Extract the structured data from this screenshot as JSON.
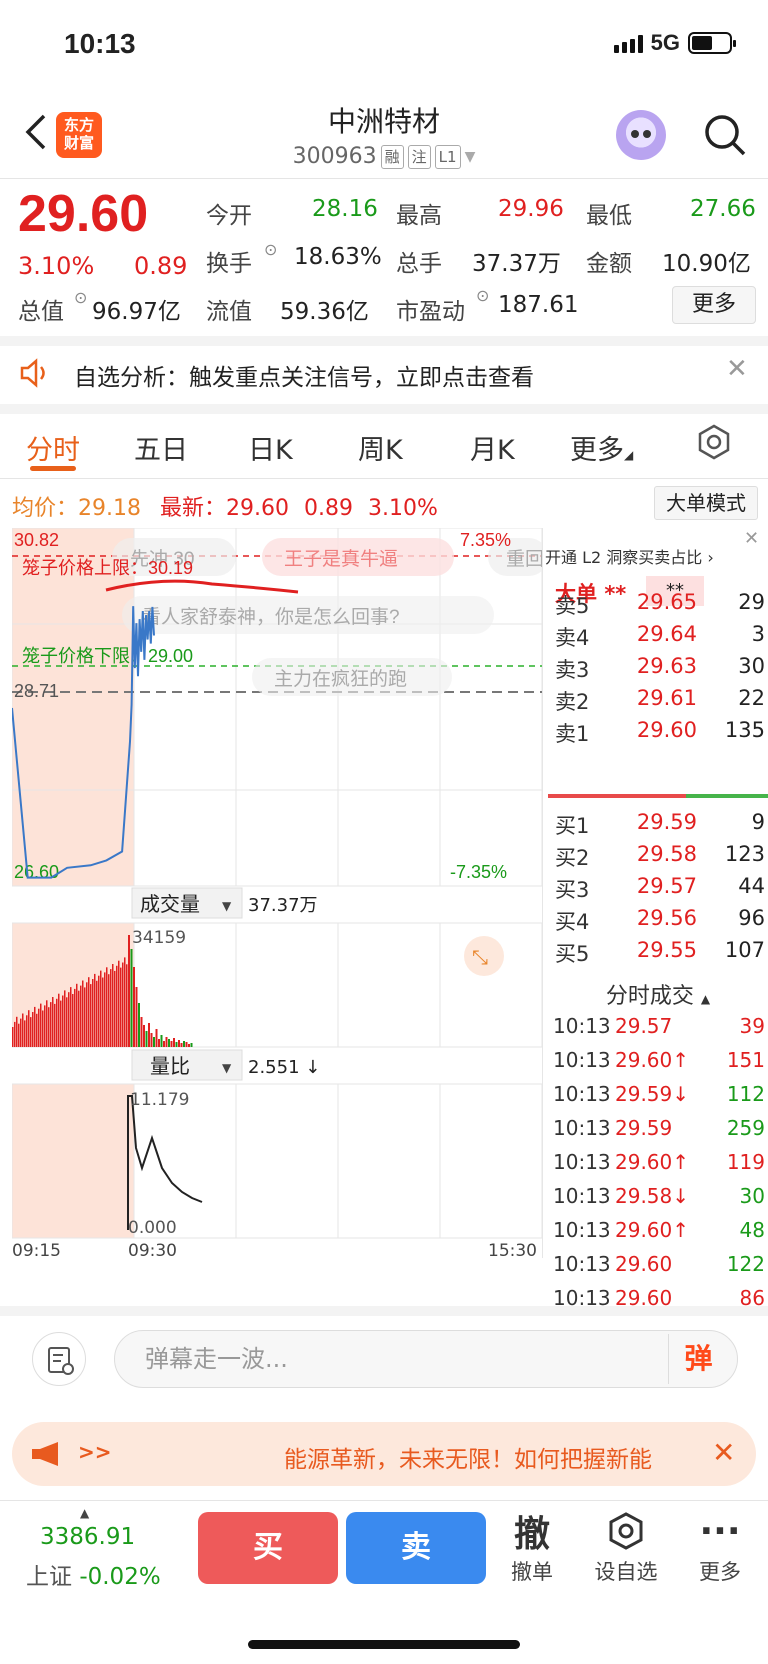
{
  "status": {
    "time": "10:13",
    "network": "5G"
  },
  "header": {
    "logo": "东方\n财富",
    "name": "中洲特材",
    "code": "300963",
    "tags": [
      "融",
      "注",
      "L1"
    ]
  },
  "quote": {
    "price": "29.60",
    "change_pct": "3.10%",
    "change_amt": "0.89",
    "fields": [
      {
        "label": "今开",
        "value": "28.16",
        "color": "green"
      },
      {
        "label": "最高",
        "value": "29.96",
        "color": "red"
      },
      {
        "label": "最低",
        "value": "27.66",
        "color": "green"
      },
      {
        "label": "换手",
        "value": "18.63%",
        "color": ""
      },
      {
        "label": "总手",
        "value": "37.37万",
        "color": ""
      },
      {
        "label": "金额",
        "value": "10.90亿",
        "color": ""
      },
      {
        "label": "总值",
        "value": "96.97亿",
        "color": ""
      },
      {
        "label": "流值",
        "value": "59.36亿",
        "color": ""
      },
      {
        "label": "市盈动",
        "value": "187.61",
        "color": ""
      }
    ],
    "more_label": "更多"
  },
  "banner": {
    "text": "自选分析：触发重点关注信号，立即点击查看"
  },
  "tabs": [
    "分时",
    "五日",
    "日K",
    "周K",
    "月K",
    "更多"
  ],
  "chart_info": {
    "avg_label": "均价：",
    "avg_value": "29.18",
    "latest_label": "最新：",
    "latest_price": "29.60",
    "latest_chg": "0.89",
    "latest_pct": "3.10%",
    "big_order_btn": "大单模式"
  },
  "chart_labels": {
    "top_price": "30.82",
    "top_pct": "7.35%",
    "mid_price": "28.71",
    "bottom_price": "26.60",
    "bottom_pct": "-7.35%",
    "upper_label": "笼子价格上限：30.19",
    "lower_label": "笼子价格下限：29.00",
    "danmu": [
      "先冲 30",
      "王子是真牛逼",
      "重回",
      "看人家舒泰神，你是怎么回事?",
      "主力在疯狂的跑"
    ],
    "volume_title": "成交量",
    "volume_total": "37.37万",
    "volume_max": "34159",
    "ratio_title": "量比",
    "ratio_value": "2.551 ↓",
    "ratio_max": "11.179",
    "ratio_min": "0.000",
    "time_start": "09:15",
    "time_open": "09:30",
    "time_end": "15:30"
  },
  "chart_data": {
    "type": "line",
    "ylim": [
      26.6,
      30.82
    ],
    "prev_close": 28.71,
    "series": [
      {
        "name": "price",
        "x": [
          "09:15",
          "09:17",
          "09:20",
          "09:22",
          "09:25",
          "09:27",
          "09:29",
          "09:30",
          "09:31",
          "09:32",
          "09:33",
          "09:34",
          "09:35",
          "09:36",
          "09:37",
          "09:38",
          "09:39",
          "09:40",
          "09:41",
          "09:42",
          "09:43",
          "09:44",
          "09:45"
        ],
        "values": [
          28.71,
          26.63,
          26.63,
          26.75,
          26.78,
          26.84,
          26.95,
          28.3,
          28.75,
          29.96,
          29.2,
          29.75,
          29.1,
          29.8,
          29.4,
          29.9,
          29.3,
          29.85,
          29.55,
          29.9,
          29.5,
          29.95,
          29.6
        ]
      }
    ]
  },
  "orderbook": {
    "l2_text": "开通 L2 洞察买卖占比",
    "big_label": "大单",
    "big_stars": "**",
    "big_stars2": "**",
    "sells": [
      {
        "label": "卖5",
        "price": "29.65",
        "vol": "29"
      },
      {
        "label": "卖4",
        "price": "29.64",
        "vol": "3"
      },
      {
        "label": "卖3",
        "price": "29.63",
        "vol": "30"
      },
      {
        "label": "卖2",
        "price": "29.61",
        "vol": "22"
      },
      {
        "label": "卖1",
        "price": "29.60",
        "vol": "135"
      }
    ],
    "buys": [
      {
        "label": "买1",
        "price": "29.59",
        "vol": "9"
      },
      {
        "label": "买2",
        "price": "29.58",
        "vol": "123"
      },
      {
        "label": "买3",
        "price": "29.57",
        "vol": "44"
      },
      {
        "label": "买4",
        "price": "29.56",
        "vol": "96"
      },
      {
        "label": "买5",
        "price": "29.55",
        "vol": "107"
      }
    ],
    "ticks_title": "分时成交",
    "ticks": [
      {
        "time": "10:13",
        "price": "29.57",
        "vol": "39",
        "pc": "red",
        "vc": "red"
      },
      {
        "time": "10:13",
        "price": "29.60↑",
        "vol": "151",
        "pc": "red",
        "vc": "red"
      },
      {
        "time": "10:13",
        "price": "29.59↓",
        "vol": "112",
        "pc": "red",
        "vc": "green"
      },
      {
        "time": "10:13",
        "price": "29.59",
        "vol": "259",
        "pc": "red",
        "vc": "green"
      },
      {
        "time": "10:13",
        "price": "29.60↑",
        "vol": "119",
        "pc": "red",
        "vc": "red"
      },
      {
        "time": "10:13",
        "price": "29.58↓",
        "vol": "30",
        "pc": "red",
        "vc": "green"
      },
      {
        "time": "10:13",
        "price": "29.60↑",
        "vol": "48",
        "pc": "red",
        "vc": "green"
      },
      {
        "time": "10:13",
        "price": "29.60",
        "vol": "122",
        "pc": "red",
        "vc": "green"
      },
      {
        "time": "10:13",
        "price": "29.60",
        "vol": "86",
        "pc": "red",
        "vc": "red"
      }
    ]
  },
  "comment": {
    "placeholder": "弹幕走一波...",
    "send": "弹"
  },
  "ad": {
    "arrows": ">>",
    "text": "能源革新，未来无限！如何把握新能"
  },
  "bottom": {
    "index_value": "3386.91",
    "index_name": "上证",
    "index_change": "-0.02%",
    "buy": "买",
    "sell": "卖",
    "items": [
      {
        "icon": "撤",
        "label": "撤单"
      },
      {
        "icon": "⬡",
        "label": "设自选"
      },
      {
        "icon": "···",
        "label": "更多"
      }
    ]
  }
}
